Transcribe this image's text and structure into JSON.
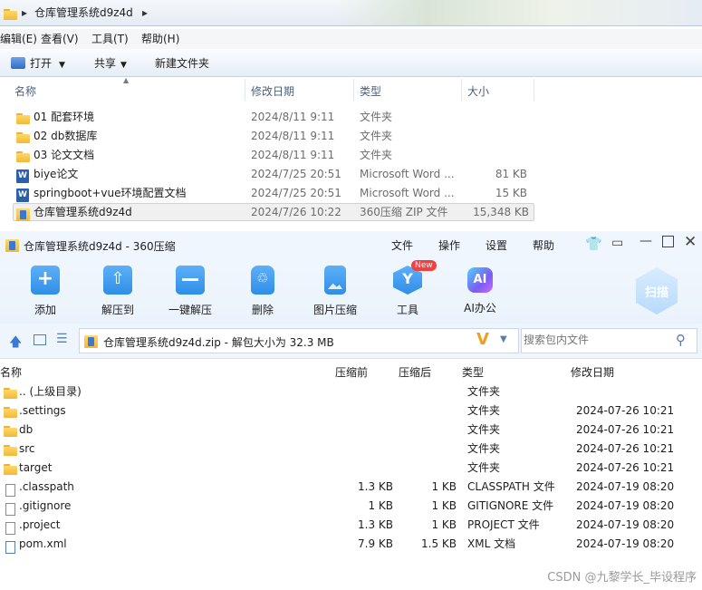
{
  "explorer": {
    "breadcrumb": "仓库管理系统d9z4d",
    "menu": [
      "编辑(E)",
      "查看(V)",
      "工具(T)",
      "帮助(H)"
    ],
    "toolbar": {
      "open": "打开",
      "share": "共享",
      "new_folder": "新建文件夹"
    },
    "columns": {
      "name": "名称",
      "modified": "修改日期",
      "type": "类型",
      "size": "大小"
    },
    "files": [
      {
        "name": "01 配套环境",
        "date": "2024/8/11 9:11",
        "type": "文件夹",
        "size": "",
        "icon": "folder-icon"
      },
      {
        "name": "02 db数据库",
        "date": "2024/8/11 9:11",
        "type": "文件夹",
        "size": "",
        "icon": "folder-icon"
      },
      {
        "name": "03 论文文档",
        "date": "2024/8/11 9:11",
        "type": "文件夹",
        "size": "",
        "icon": "folder-icon"
      },
      {
        "name": "biye论文",
        "date": "2024/7/25 20:51",
        "type": "Microsoft Word ...",
        "size": "81 KB",
        "icon": "word-icon"
      },
      {
        "name": "springboot+vue环境配置文档",
        "date": "2024/7/25 20:51",
        "type": "Microsoft Word ...",
        "size": "15 KB",
        "icon": "word-icon"
      },
      {
        "name": "仓库管理系统d9z4d",
        "date": "2024/7/26 10:22",
        "type": "360压缩 ZIP 文件",
        "size": "15,348 KB",
        "icon": "zip-icon"
      }
    ]
  },
  "zip": {
    "title": "仓库管理系统d9z4d - 360压缩",
    "menu": [
      "文件",
      "操作",
      "设置",
      "帮助"
    ],
    "ribbon": [
      {
        "label": "添加",
        "icon": "add-icon",
        "color": "#2f8ee8"
      },
      {
        "label": "解压到",
        "icon": "extract-to-icon",
        "color": "#2f8ee8"
      },
      {
        "label": "一键解压",
        "icon": "one-click-extract-icon",
        "color": "#2f8ee8"
      },
      {
        "label": "删除",
        "icon": "delete-icon",
        "color": "#2f8ee8"
      },
      {
        "label": "图片压缩",
        "icon": "image-compress-icon",
        "color": "#2f8ee8"
      },
      {
        "label": "工具",
        "icon": "tools-icon",
        "color": "#2f8ee8"
      },
      {
        "label": "AI办公",
        "icon": "ai-office-icon",
        "color": "#7b5cf0"
      }
    ],
    "new_badge": "New",
    "ai_text": "AI",
    "scan_label": "扫描",
    "path": "仓库管理系统d9z4d.zip - 解包大小为 32.3 MB",
    "search_placeholder": "搜索包内文件",
    "columns": {
      "name": "名称",
      "packed": "压缩前",
      "compressed": "压缩后",
      "type": "类型",
      "modified": "修改日期"
    },
    "files": [
      {
        "name": ".. (上级目录)",
        "before": "",
        "after": "",
        "type": "文件夹",
        "date": "",
        "icon": "folder-icon"
      },
      {
        "name": ".settings",
        "before": "",
        "after": "",
        "type": "文件夹",
        "date": "2024-07-26 10:21",
        "icon": "folder-icon"
      },
      {
        "name": "db",
        "before": "",
        "after": "",
        "type": "文件夹",
        "date": "2024-07-26 10:21",
        "icon": "folder-icon"
      },
      {
        "name": "src",
        "before": "",
        "after": "",
        "type": "文件夹",
        "date": "2024-07-26 10:21",
        "icon": "folder-icon"
      },
      {
        "name": "target",
        "before": "",
        "after": "",
        "type": "文件夹",
        "date": "2024-07-26 10:21",
        "icon": "folder-icon"
      },
      {
        "name": ".classpath",
        "before": "1.3 KB",
        "after": "1 KB",
        "type": "CLASSPATH 文件",
        "date": "2024-07-19 08:20",
        "icon": "file-icon"
      },
      {
        "name": ".gitignore",
        "before": "1 KB",
        "after": "1 KB",
        "type": "GITIGNORE 文件",
        "date": "2024-07-19 08:20",
        "icon": "file-icon"
      },
      {
        "name": ".project",
        "before": "1.3 KB",
        "after": "1 KB",
        "type": "PROJECT 文件",
        "date": "2024-07-19 08:20",
        "icon": "file-icon"
      },
      {
        "name": "pom.xml",
        "before": "7.9 KB",
        "after": "1.5 KB",
        "type": "XML 文档",
        "date": "2024-07-19 08:20",
        "icon": "xml-file-icon"
      }
    ]
  },
  "watermark": "CSDN @九黎学长_毕设程序"
}
